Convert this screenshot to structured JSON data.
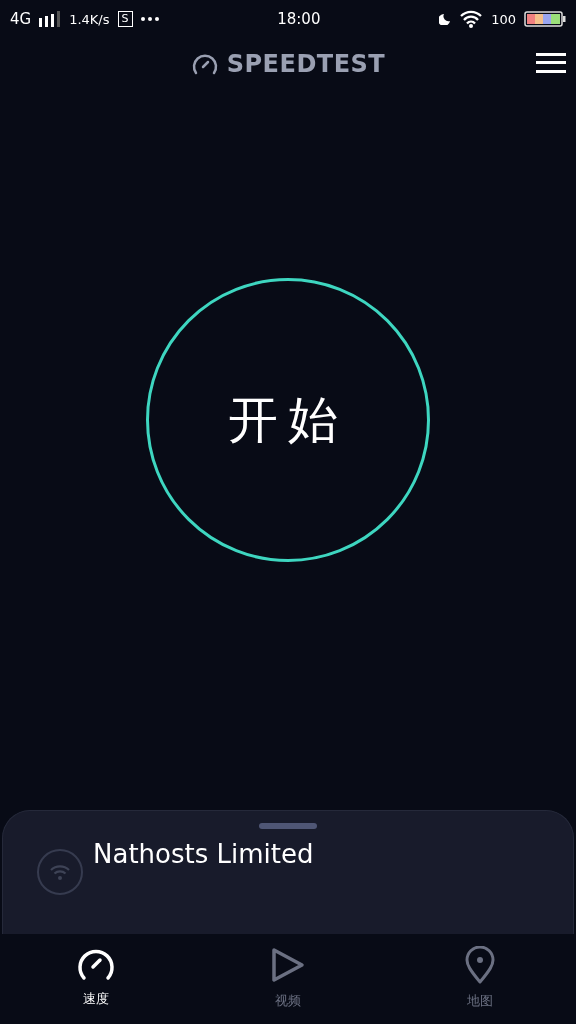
{
  "status_bar": {
    "network": "4G",
    "speed": "1.4K/s",
    "app_badge": "S",
    "time": "18:00",
    "battery": "100"
  },
  "header": {
    "title": "SPEEDTEST"
  },
  "start_button": {
    "label": "开始"
  },
  "server_sheet": {
    "provider": "Nathosts Limited"
  },
  "tabs": [
    {
      "label": "速度",
      "kind": "speed",
      "selected": true
    },
    {
      "label": "视频",
      "kind": "video",
      "selected": false
    },
    {
      "label": "地图",
      "kind": "map",
      "selected": false
    }
  ]
}
